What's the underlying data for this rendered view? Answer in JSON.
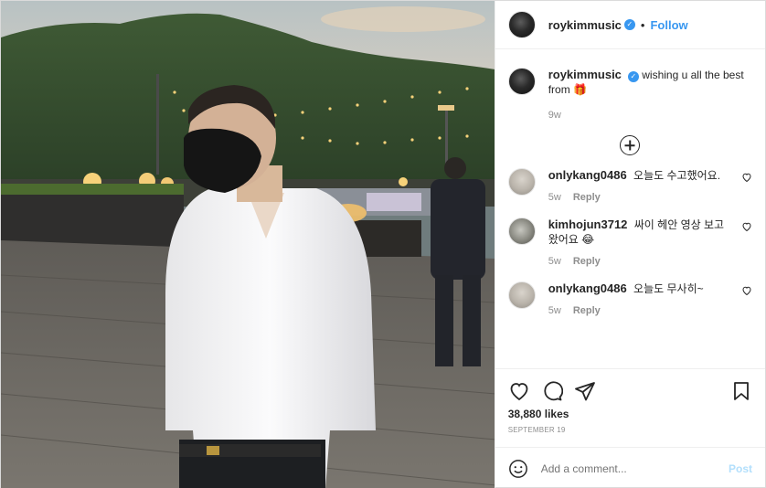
{
  "post": {
    "author": "roykimmusic",
    "verified": true,
    "follow_label": "Follow",
    "separator": "•"
  },
  "caption": {
    "username": "roykimmusic",
    "text": "wishing u all the best from 🎁",
    "time": "9w"
  },
  "comments": [
    {
      "username": "onlykang0486",
      "text": "오늘도 수고했어요.",
      "time": "5w",
      "reply_label": "Reply"
    },
    {
      "username": "kimhojun3712",
      "text": "싸이 헤안 영상 보고 왔어요",
      "time": "5w",
      "reply_label": "Reply",
      "emoji": "😂"
    },
    {
      "username": "onlykang0486",
      "text": "오늘도 무사히~",
      "time": "5w",
      "reply_label": "Reply"
    }
  ],
  "stats": {
    "likes": "38,880 likes",
    "date": "SEPTEMBER 19"
  },
  "add_comment": {
    "placeholder": "Add a comment...",
    "post_label": "Post"
  },
  "icons": {
    "like": "heart-icon",
    "comment": "comment-bubble-icon",
    "share": "paper-plane-icon",
    "save": "bookmark-icon",
    "emoji": "smiley-icon",
    "load_more": "plus-circle-icon",
    "verified": "verified-badge-icon"
  },
  "colors": {
    "accent": "#3897f0",
    "muted": "#8e8e8e",
    "post_disabled": "#b2dffc"
  }
}
